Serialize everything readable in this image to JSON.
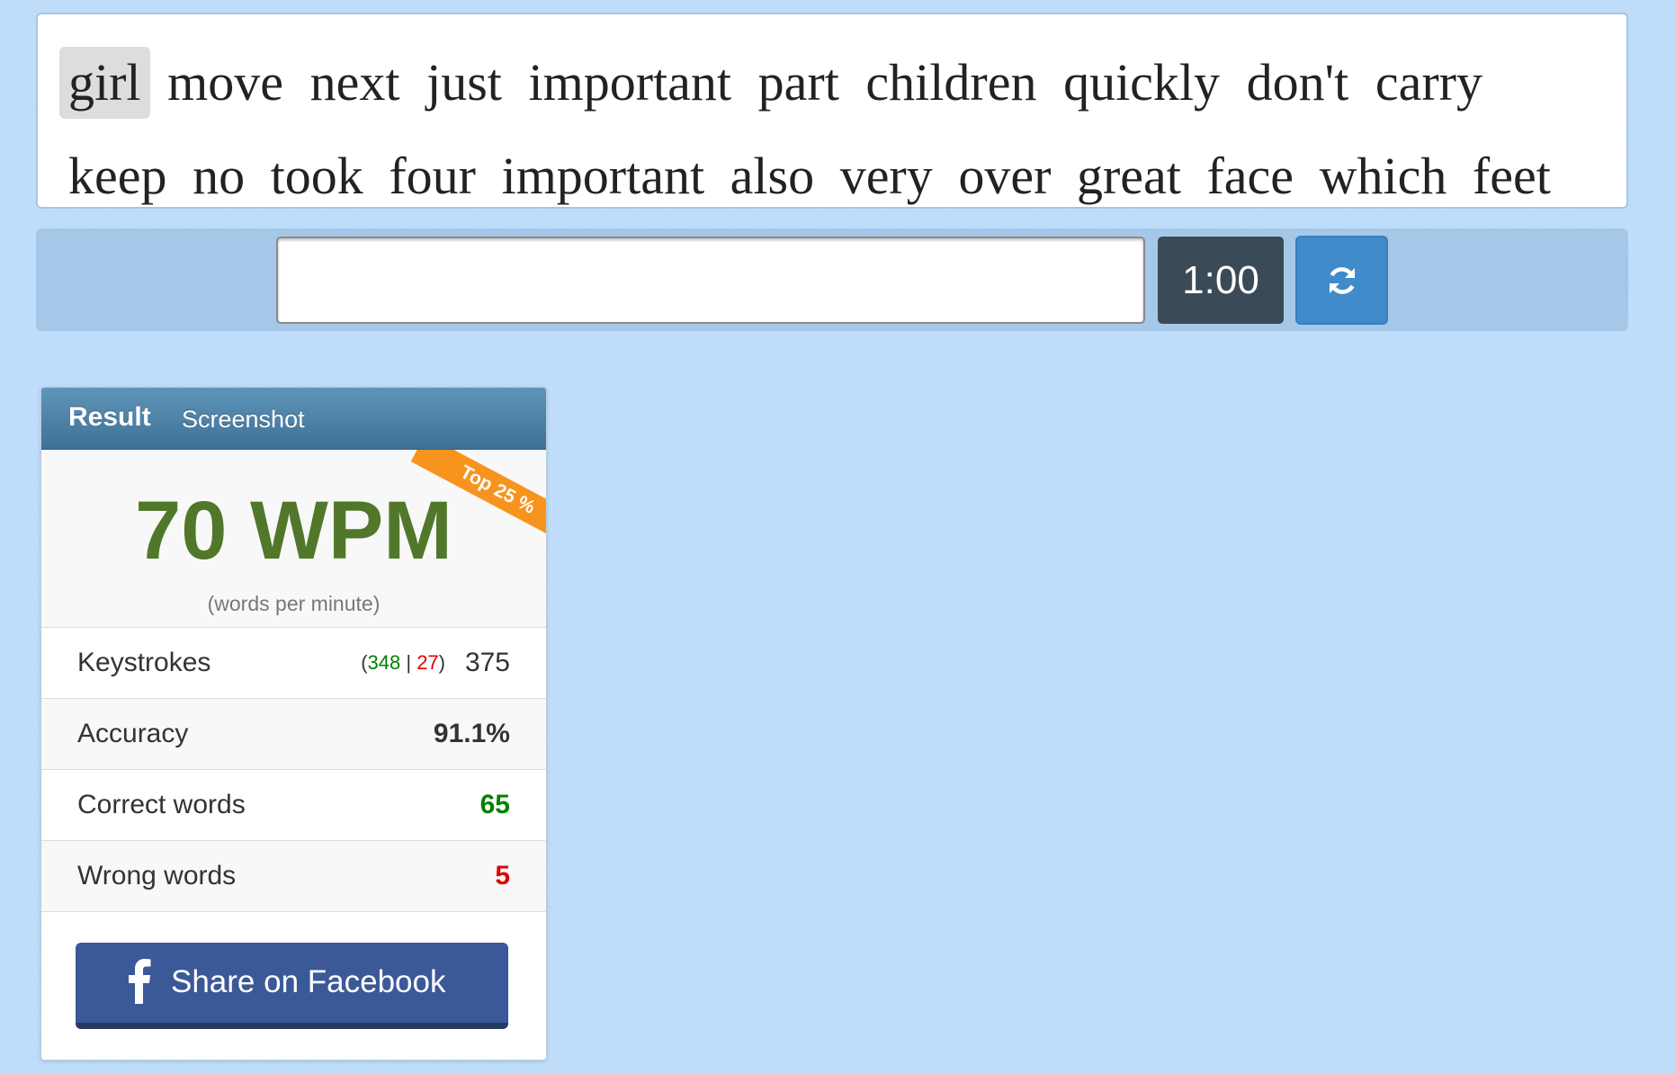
{
  "words": {
    "row1": [
      "girl",
      "move",
      "next",
      "just",
      "important",
      "part",
      "children",
      "quickly",
      "don't",
      "carry"
    ],
    "row2": [
      "keep",
      "no",
      "took",
      "four",
      "important",
      "also",
      "very",
      "over",
      "great",
      "face",
      "which",
      "feet"
    ],
    "current_word": "girl"
  },
  "input": {
    "value": "",
    "placeholder": ""
  },
  "timer": "1:00",
  "reload": {
    "icon": "refresh-icon"
  },
  "result": {
    "tabs": {
      "result": "Result",
      "screenshot": "Screenshot"
    },
    "ribbon": "Top 25 %",
    "wpm": "70 WPM",
    "wpm_caption": "(words per minute)",
    "keystrokes": {
      "label": "Keystrokes",
      "correct": "348",
      "wrong": "27",
      "total": "375"
    },
    "accuracy": {
      "label": "Accuracy",
      "value": "91.1%"
    },
    "correct_words": {
      "label": "Correct words",
      "value": "65"
    },
    "wrong_words": {
      "label": "Wrong words",
      "value": "5"
    },
    "share": {
      "label": "Share on Facebook",
      "icon": "facebook-icon"
    }
  },
  "colors": {
    "background": "#bddcfa",
    "wpm": "#51782a",
    "ribbon": "#f7941d",
    "timer_bg": "#3b4a57",
    "reload_bg": "#428bca",
    "facebook": "#3b5998",
    "correct": "#008000",
    "wrong": "#e00000"
  }
}
